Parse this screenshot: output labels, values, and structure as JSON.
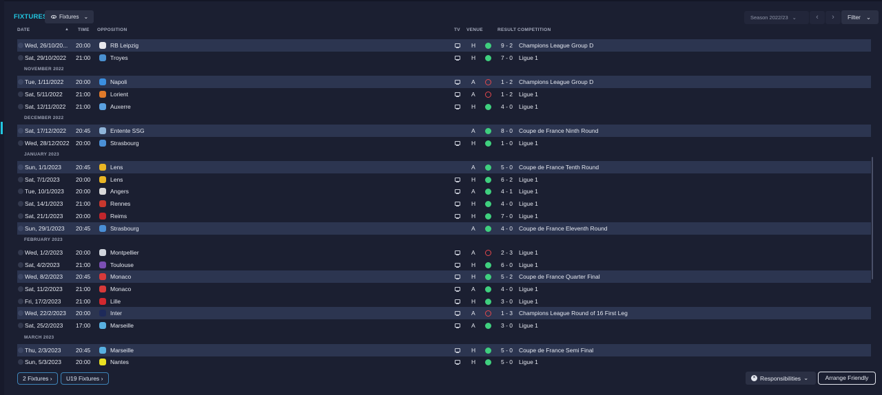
{
  "header": {
    "title": "FIXTURES",
    "view_dropdown": "Fixtures",
    "season": "Season 2022/23",
    "filter_label": "Filter"
  },
  "columns": {
    "date": "DATE",
    "time": "TIME",
    "opposition": "OPPOSITION",
    "tv": "TV",
    "venue": "VENUE",
    "result": "RESULT",
    "competition": "COMPETITION"
  },
  "rows": [
    {
      "type": "fixture",
      "date": "Wed, 26/10/20...",
      "time": "20:00",
      "opponent": "RB Leipzig",
      "tv": true,
      "venue": "H",
      "outcome": "W",
      "score": "9 - 2",
      "competition": "Champions League Group D",
      "highlight": true,
      "badge_color": "#e8e8ee"
    },
    {
      "type": "fixture",
      "date": "Sat, 29/10/2022",
      "time": "21:00",
      "opponent": "Troyes",
      "tv": true,
      "venue": "H",
      "outcome": "W",
      "score": "7 - 0",
      "competition": "Ligue 1",
      "highlight": false,
      "badge_color": "#4a90d0"
    },
    {
      "type": "month",
      "label": "NOVEMBER 2022"
    },
    {
      "type": "fixture",
      "date": "Tue, 1/11/2022",
      "time": "20:00",
      "opponent": "Napoli",
      "tv": true,
      "venue": "A",
      "outcome": "L",
      "score": "1 - 2",
      "competition": "Champions League Group D",
      "highlight": true,
      "badge_color": "#3b8fe0"
    },
    {
      "type": "fixture",
      "date": "Sat, 5/11/2022",
      "time": "21:00",
      "opponent": "Lorient",
      "tv": true,
      "venue": "A",
      "outcome": "L",
      "score": "1 - 2",
      "competition": "Ligue 1",
      "highlight": false,
      "badge_color": "#e07a2a"
    },
    {
      "type": "fixture",
      "date": "Sat, 12/11/2022",
      "time": "21:00",
      "opponent": "Auxerre",
      "tv": true,
      "venue": "H",
      "outcome": "W",
      "score": "4 - 0",
      "competition": "Ligue 1",
      "highlight": false,
      "badge_color": "#5aa0e0"
    },
    {
      "type": "month",
      "label": "DECEMBER 2022"
    },
    {
      "type": "fixture",
      "date": "Sat, 17/12/2022",
      "time": "20:45",
      "opponent": "Entente SSG",
      "tv": false,
      "venue": "A",
      "outcome": "W",
      "score": "8 - 0",
      "competition": "Coupe de France Ninth Round",
      "highlight": true,
      "badge_color": "#8fb4d8"
    },
    {
      "type": "fixture",
      "date": "Wed, 28/12/2022",
      "time": "20:00",
      "opponent": "Strasbourg",
      "tv": true,
      "venue": "H",
      "outcome": "W",
      "score": "1 - 0",
      "competition": "Ligue 1",
      "highlight": false,
      "badge_color": "#4a8fd6"
    },
    {
      "type": "month",
      "label": "JANUARY 2023"
    },
    {
      "type": "fixture",
      "date": "Sun, 1/1/2023",
      "time": "20:45",
      "opponent": "Lens",
      "tv": false,
      "venue": "A",
      "outcome": "W",
      "score": "5 - 0",
      "competition": "Coupe de France Tenth Round",
      "highlight": true,
      "badge_color": "#e9b524"
    },
    {
      "type": "fixture",
      "date": "Sat, 7/1/2023",
      "time": "20:00",
      "opponent": "Lens",
      "tv": true,
      "venue": "H",
      "outcome": "W",
      "score": "6 - 2",
      "competition": "Ligue 1",
      "highlight": false,
      "badge_color": "#e9b524"
    },
    {
      "type": "fixture",
      "date": "Tue, 10/1/2023",
      "time": "20:00",
      "opponent": "Angers",
      "tv": true,
      "venue": "A",
      "outcome": "W",
      "score": "4 - 1",
      "competition": "Ligue 1",
      "highlight": false,
      "badge_color": "#d8d8d8"
    },
    {
      "type": "fixture",
      "date": "Sat, 14/1/2023",
      "time": "21:00",
      "opponent": "Rennes",
      "tv": true,
      "venue": "H",
      "outcome": "W",
      "score": "4 - 0",
      "competition": "Ligue 1",
      "highlight": false,
      "badge_color": "#c8382e"
    },
    {
      "type": "fixture",
      "date": "Sat, 21/1/2023",
      "time": "20:00",
      "opponent": "Reims",
      "tv": true,
      "venue": "H",
      "outcome": "W",
      "score": "7 - 0",
      "competition": "Ligue 1",
      "highlight": false,
      "badge_color": "#c0262c"
    },
    {
      "type": "fixture",
      "date": "Sun, 29/1/2023",
      "time": "20:45",
      "opponent": "Strasbourg",
      "tv": false,
      "venue": "A",
      "outcome": "W",
      "score": "4 - 0",
      "competition": "Coupe de France Eleventh Round",
      "highlight": true,
      "badge_color": "#4a8fd6"
    },
    {
      "type": "month",
      "label": "FEBRUARY 2023"
    },
    {
      "type": "fixture",
      "date": "Wed, 1/2/2023",
      "time": "20:00",
      "opponent": "Montpellier",
      "tv": true,
      "venue": "A",
      "outcome": "L",
      "score": "2 - 3",
      "competition": "Ligue 1",
      "highlight": false,
      "badge_color": "#d0d4dc"
    },
    {
      "type": "fixture",
      "date": "Sat, 4/2/2023",
      "time": "21:00",
      "opponent": "Toulouse",
      "tv": true,
      "venue": "H",
      "outcome": "W",
      "score": "6 - 0",
      "competition": "Ligue 1",
      "highlight": false,
      "badge_color": "#7b4fb5"
    },
    {
      "type": "fixture",
      "date": "Wed, 8/2/2023",
      "time": "20:45",
      "opponent": "Monaco",
      "tv": true,
      "venue": "H",
      "outcome": "W",
      "score": "5 - 2",
      "competition": "Coupe de France Quarter Final",
      "highlight": true,
      "badge_color": "#d83a3a"
    },
    {
      "type": "fixture",
      "date": "Sat, 11/2/2023",
      "time": "21:00",
      "opponent": "Monaco",
      "tv": true,
      "venue": "A",
      "outcome": "W",
      "score": "4 - 0",
      "competition": "Ligue 1",
      "highlight": false,
      "badge_color": "#d83a3a"
    },
    {
      "type": "fixture",
      "date": "Fri, 17/2/2023",
      "time": "21:00",
      "opponent": "Lille",
      "tv": true,
      "venue": "H",
      "outcome": "W",
      "score": "3 - 0",
      "competition": "Ligue 1",
      "highlight": false,
      "badge_color": "#d2282f"
    },
    {
      "type": "fixture",
      "date": "Wed, 22/2/2023",
      "time": "20:00",
      "opponent": "Inter",
      "tv": true,
      "venue": "A",
      "outcome": "L",
      "score": "1 - 3",
      "competition": "Champions League Round of 16  First Leg",
      "highlight": true,
      "badge_color": "#1e2a5a"
    },
    {
      "type": "fixture",
      "date": "Sat, 25/2/2023",
      "time": "17:00",
      "opponent": "Marseille",
      "tv": true,
      "venue": "A",
      "outcome": "W",
      "score": "3 - 0",
      "competition": "Ligue 1",
      "highlight": false,
      "badge_color": "#58b0e0"
    },
    {
      "type": "month",
      "label": "MARCH 2023"
    },
    {
      "type": "fixture",
      "date": "Thu, 2/3/2023",
      "time": "20:45",
      "opponent": "Marseille",
      "tv": true,
      "venue": "H",
      "outcome": "W",
      "score": "5 - 0",
      "competition": "Coupe de France Semi Final",
      "highlight": true,
      "badge_color": "#58b0e0"
    },
    {
      "type": "fixture",
      "date": "Sun, 5/3/2023",
      "time": "20:00",
      "opponent": "Nantes",
      "tv": true,
      "venue": "H",
      "outcome": "W",
      "score": "5 - 0",
      "competition": "Ligue 1",
      "highlight": false,
      "badge_color": "#e8e022"
    }
  ],
  "footer": {
    "fixtures_button": "2 Fixtures",
    "u19_button": "U19 Fixtures",
    "responsibilities_button": "Responsibilities",
    "arrange_friendly_button": "Arrange Friendly"
  },
  "colors": {
    "accent": "#22c6e0",
    "win": "#3fcf7e",
    "loss": "#e5484d",
    "highlight_row": "#2c3550",
    "background": "#1b1f31"
  }
}
